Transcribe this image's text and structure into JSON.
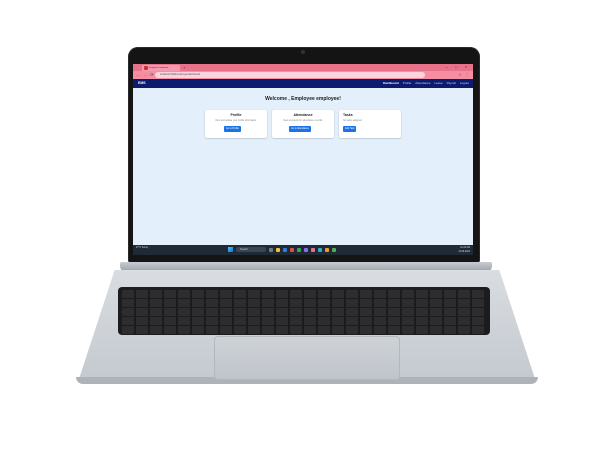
{
  "browser": {
    "tab_title": "Employee Dashboard",
    "new_tab_glyph": "+",
    "window_controls": "— ▢ ✕",
    "url": "localhost:5000/employee/dashboard",
    "nav_glyphs": "← → ⟳",
    "ext_glyphs": "☆ ⋮"
  },
  "app": {
    "brand": "EMS",
    "nav": [
      "Dashboard",
      "Profile",
      "Attendance",
      "Leave",
      "Payroll",
      "Logout"
    ],
    "welcome": "Welcome , Employee employee!"
  },
  "cards": [
    {
      "title": "Profile",
      "text": "View and update your profile information.",
      "button": "Go to Profile"
    },
    {
      "title": "Attendance",
      "text": "View and apply for attendance records.",
      "button": "Go to Attendance"
    },
    {
      "title": "Tasks",
      "text": "No tasks assigned.",
      "button": "Add Task"
    }
  ],
  "taskbar": {
    "weather": "27°C",
    "weather_sub": "Sunny",
    "search": "Search",
    "time": "10:24 AM",
    "date": "11-09-2024"
  },
  "colors": {
    "browser_tab": "#e9728b",
    "navbar": "#0d1b6e",
    "page_bg": "#e3f0fb",
    "button": "#1a73e8",
    "taskbar": "#1f2a36"
  }
}
